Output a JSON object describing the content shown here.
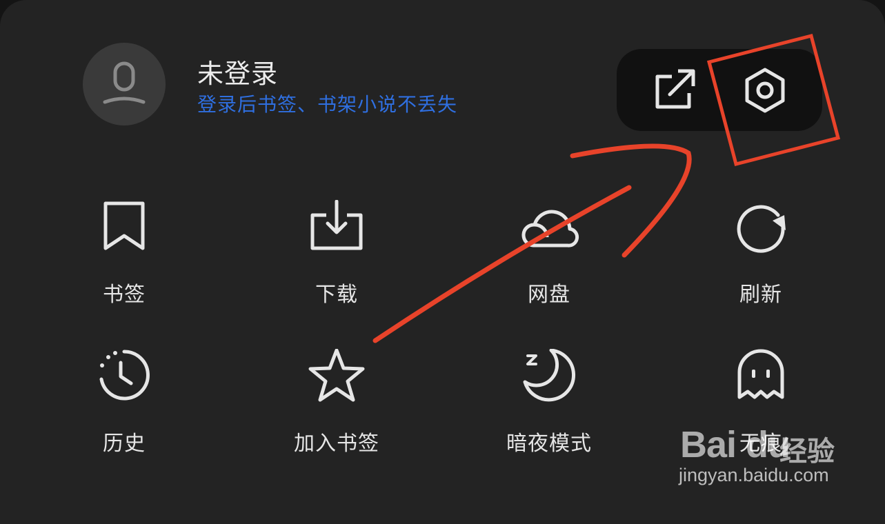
{
  "header": {
    "username": "未登录",
    "login_hint": "登录后书签、书架小说不丢失"
  },
  "toolbar": {
    "share_icon": "share-out-icon",
    "settings_icon": "settings-hexagon-icon"
  },
  "grid": {
    "items": [
      {
        "label": "书签",
        "icon": "bookmark-icon"
      },
      {
        "label": "下载",
        "icon": "download-icon"
      },
      {
        "label": "网盘",
        "icon": "cloud-icon"
      },
      {
        "label": "刷新",
        "icon": "refresh-icon"
      },
      {
        "label": "历史",
        "icon": "history-clock-icon"
      },
      {
        "label": "加入书签",
        "icon": "star-icon"
      },
      {
        "label": "暗夜模式",
        "icon": "moon-icon"
      },
      {
        "label": "无痕",
        "icon": "ghost-icon"
      }
    ]
  },
  "watermark": {
    "logo": "Bai du",
    "logo_suffix": "经验",
    "url": "jingyan.baidu.com"
  },
  "colors": {
    "background": "#232323",
    "hint_blue": "#2f6fe0",
    "annotation_red": "#e8432a"
  }
}
